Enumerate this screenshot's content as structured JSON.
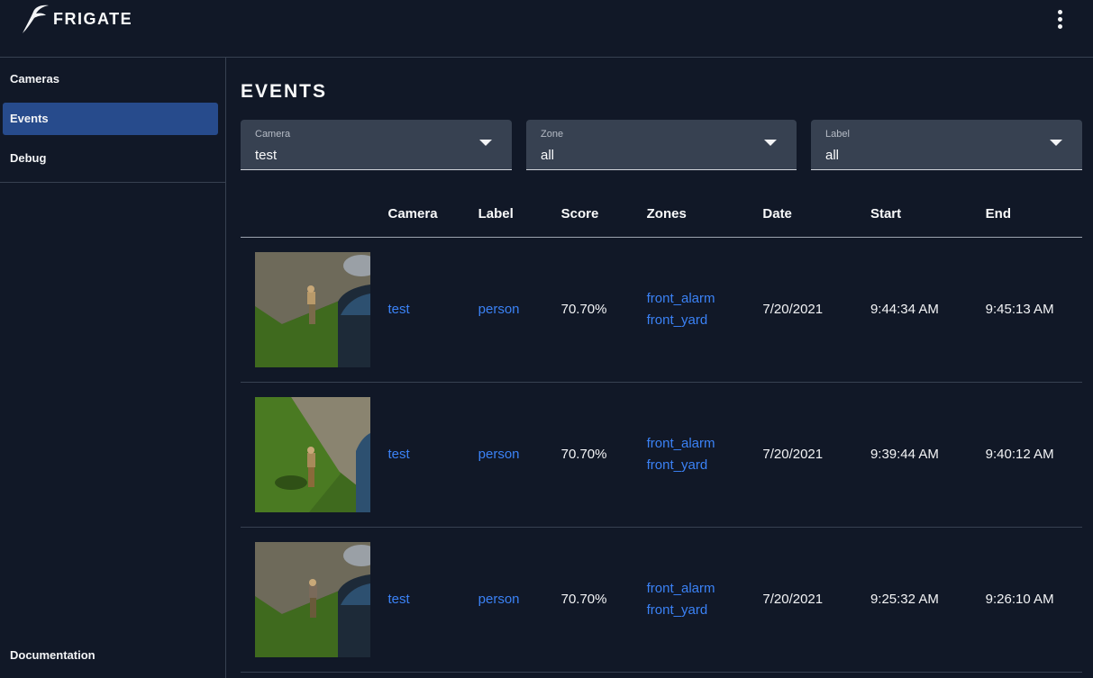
{
  "app": {
    "brand": "FRIGATE"
  },
  "sidebar": {
    "items": [
      {
        "label": "Cameras",
        "active": false
      },
      {
        "label": "Events",
        "active": true
      },
      {
        "label": "Debug",
        "active": false
      }
    ],
    "documentation": "Documentation"
  },
  "page": {
    "title": "EVENTS"
  },
  "filters": {
    "camera": {
      "label": "Camera",
      "value": "test"
    },
    "zone": {
      "label": "Zone",
      "value": "all"
    },
    "label": {
      "label": "Label",
      "value": "all"
    }
  },
  "table": {
    "headers": [
      "",
      "Camera",
      "Label",
      "Score",
      "Zones",
      "Date",
      "Start",
      "End"
    ],
    "rows": [
      {
        "camera": "test",
        "label": "person",
        "score": "70.70%",
        "zones": [
          "front_alarm",
          "front_yard"
        ],
        "date": "7/20/2021",
        "start": "9:44:34 AM",
        "end": "9:45:13 AM"
      },
      {
        "camera": "test",
        "label": "person",
        "score": "70.70%",
        "zones": [
          "front_alarm",
          "front_yard"
        ],
        "date": "7/20/2021",
        "start": "9:39:44 AM",
        "end": "9:40:12 AM"
      },
      {
        "camera": "test",
        "label": "person",
        "score": "70.70%",
        "zones": [
          "front_alarm",
          "front_yard"
        ],
        "date": "7/20/2021",
        "start": "9:25:32 AM",
        "end": "9:26:10 AM"
      }
    ]
  },
  "icons": {
    "logo": "frigate-bird-icon",
    "menu": "more-vertical-icon",
    "dropdown": "chevron-down-icon"
  },
  "colors": {
    "accent": "#274b8c",
    "link": "#3b82f6",
    "background": "#111827"
  }
}
